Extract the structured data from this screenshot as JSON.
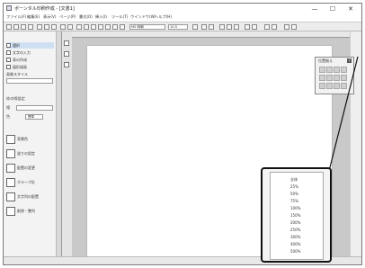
{
  "window": {
    "title": "ポーンタル印刷作成 - [文書1]",
    "controls": [
      "—",
      "☐",
      "✕"
    ]
  },
  "menu": [
    "ファイル(F)",
    "編集(E)",
    "表示(V)",
    "ページ(P)",
    "書式(O)",
    "挿入(I)",
    "ツール(T)",
    "ウインドウ(W)",
    "ヘルプ(H)"
  ],
  "toolbar": {
    "font_select": "MS 明朝",
    "size_select": "10.5"
  },
  "sidebar": {
    "items": [
      {
        "label": "選択"
      },
      {
        "label": "文字の入力"
      },
      {
        "label": "表の作成"
      },
      {
        "label": "図形描画"
      },
      {
        "label": "画像スタイル"
      }
    ],
    "section_label": "枠の線設定",
    "width_label": "線",
    "color_label": "色",
    "color_value": "標準",
    "tools": [
      {
        "label": "背景色"
      },
      {
        "label": "塗りの設定"
      },
      {
        "label": "配置の変更"
      },
      {
        "label": "グループ化"
      },
      {
        "label": "文字列の配置"
      },
      {
        "label": "削除・整列"
      }
    ]
  },
  "palette": {
    "title": "位置揃え",
    "help": "?"
  },
  "zoom": {
    "options": [
      "全体",
      "25%",
      "50%",
      "75%",
      "100%",
      "150%",
      "200%",
      "250%",
      "300%",
      "400%",
      "500%"
    ]
  }
}
